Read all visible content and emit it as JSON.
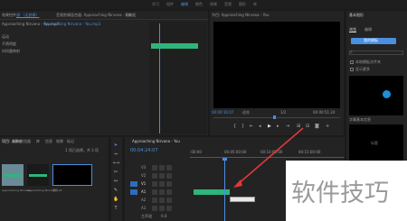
{
  "workspaces": [
    "学习",
    "组件",
    "编辑",
    "颜色",
    "效果",
    "音频",
    "图形",
    "库"
  ],
  "source_panel": {
    "tabs": [
      "效果控件",
      "源:（无剪辑）",
      "音频剪辑混合器: Approaching Nirvana - You",
      "元数据"
    ],
    "sequence_label": "Approaching Nirvana - You.mp3",
    "clip_label": "Approaching Nirvana - You.mp3",
    "rows": [
      "运动",
      "不透明度",
      "时间重映射"
    ]
  },
  "program_monitor": {
    "tab": "节目: Approaching Nirvana - You",
    "timecode_left": "00:00:16:07",
    "fit": "适合",
    "quality": "1/2",
    "timecode_right": "00:00:51:24",
    "transport": [
      "mark-in",
      "mark-out",
      "go-to-in",
      "step-back",
      "play",
      "step-forward",
      "go-to-out",
      "insert",
      "overwrite",
      "export-frame",
      "plus"
    ]
  },
  "essential_graphics": {
    "title": "基本图形",
    "tabs": [
      "浏览",
      "编辑"
    ],
    "dropdown": "我的模板",
    "checkboxes": [
      "本地模板文件夹",
      "显示更多"
    ],
    "section": "字幕基本信息",
    "thumb_label": "标题"
  },
  "project_panel": {
    "tabs": [
      "项目: 未命名",
      "媒体浏览器",
      "库",
      "信息",
      "效果",
      "标记"
    ],
    "status": "1 项已选择，共 3 项",
    "items": [
      "Approaching Nirvana...",
      "Approaching Nirvana...",
      "序列 01"
    ]
  },
  "timeline": {
    "tab": "Approaching Nirvana - You",
    "timecode": "00:04:24:07",
    "ruler": [
      ":00:00",
      "00:05:00:00",
      "00:10:00:00",
      "00:15:00:00"
    ],
    "tracks": [
      "V3",
      "V2",
      "V1",
      "A1",
      "A2",
      "A3",
      "主声道"
    ],
    "master_value": "0.0"
  },
  "tools": [
    "select",
    "track-select",
    "ripple",
    "razor",
    "slip",
    "pen",
    "hand",
    "type"
  ],
  "watermark": "软件技巧",
  "colors": {
    "accent": "#4a8fe0",
    "clip": "#2fb47c",
    "annotation": "#e03a3a"
  }
}
